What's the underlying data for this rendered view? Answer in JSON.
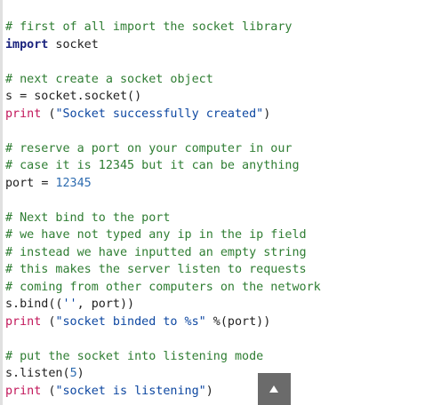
{
  "code_lines": [
    [
      {
        "t": "# first of all import the socket library",
        "c": "comment"
      }
    ],
    [
      {
        "t": "import",
        "c": "keyword"
      },
      {
        "t": " socket",
        "c": "plain"
      }
    ],
    [],
    [
      {
        "t": "# next create a socket object",
        "c": "comment"
      }
    ],
    [
      {
        "t": "s ",
        "c": "plain"
      },
      {
        "t": "=",
        "c": "op"
      },
      {
        "t": " socket.socket()",
        "c": "plain"
      }
    ],
    [
      {
        "t": "print",
        "c": "builtin"
      },
      {
        "t": " (",
        "c": "plain"
      },
      {
        "t": "\"Socket successfully created\"",
        "c": "string"
      },
      {
        "t": ")",
        "c": "plain"
      }
    ],
    [],
    [
      {
        "t": "# reserve a port on your computer in our",
        "c": "comment"
      }
    ],
    [
      {
        "t": "# case it is 12345 but it can be anything",
        "c": "comment"
      }
    ],
    [
      {
        "t": "port ",
        "c": "plain"
      },
      {
        "t": "=",
        "c": "op"
      },
      {
        "t": " ",
        "c": "plain"
      },
      {
        "t": "12345",
        "c": "number"
      }
    ],
    [],
    [
      {
        "t": "# Next bind to the port",
        "c": "comment"
      }
    ],
    [
      {
        "t": "# we have not typed any ip in the ip field",
        "c": "comment"
      }
    ],
    [
      {
        "t": "# instead we have inputted an empty string",
        "c": "comment"
      }
    ],
    [
      {
        "t": "# this makes the server listen to requests",
        "c": "comment"
      }
    ],
    [
      {
        "t": "# coming from other computers on the network",
        "c": "comment"
      }
    ],
    [
      {
        "t": "s.bind((",
        "c": "plain"
      },
      {
        "t": "''",
        "c": "string"
      },
      {
        "t": ", port))",
        "c": "plain"
      }
    ],
    [
      {
        "t": "print",
        "c": "builtin"
      },
      {
        "t": " (",
        "c": "plain"
      },
      {
        "t": "\"socket binded to %s\"",
        "c": "string"
      },
      {
        "t": " %(port))",
        "c": "plain"
      }
    ],
    [],
    [
      {
        "t": "# put the socket into listening mode",
        "c": "comment"
      }
    ],
    [
      {
        "t": "s.listen(",
        "c": "plain"
      },
      {
        "t": "5",
        "c": "number"
      },
      {
        "t": ")",
        "c": "plain"
      }
    ],
    [
      {
        "t": "print",
        "c": "builtin"
      },
      {
        "t": " (",
        "c": "plain"
      },
      {
        "t": "\"socket is listening\"",
        "c": "string"
      },
      {
        "t": ")",
        "c": "plain"
      }
    ]
  ],
  "scroll_top_button": {
    "icon": "arrow-up-icon",
    "background": "#6b6b6b"
  },
  "colors": {
    "comment": "#2e7d32",
    "keyword": "#1a237e",
    "builtin": "#c2185b",
    "string": "#0d47a1",
    "number": "#2e6cb0"
  }
}
